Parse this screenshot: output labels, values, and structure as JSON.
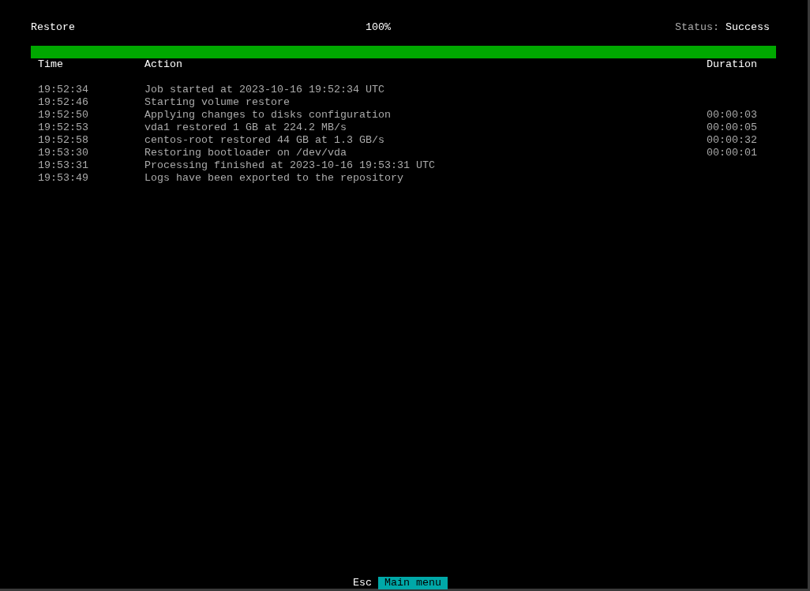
{
  "header": {
    "title": "Restore",
    "percent": "100%",
    "status_label": "Status:",
    "status_value": "Success"
  },
  "progress": {
    "level": 1.0
  },
  "table": {
    "columns": [
      "Time",
      "Action",
      "Duration"
    ],
    "rows": [
      {
        "time": "19:52:34",
        "action": "Job started at 2023-10-16 19:52:34 UTC"
      },
      {
        "time": "19:52:46",
        "action": "Starting volume restore"
      },
      {
        "time": "19:52:50",
        "action": "Applying changes to disks configuration",
        "duration": "00:00:03"
      },
      {
        "time": "19:52:53",
        "action": "vda1 restored 1 GB at 224.2 MB/s",
        "duration": "00:00:05"
      },
      {
        "time": "19:52:58",
        "action": "centos-root restored 44 GB at 1.3 GB/s",
        "duration": "00:00:32"
      },
      {
        "time": "19:53:30",
        "action": "Restoring bootloader on /dev/vda",
        "duration": "00:00:01"
      },
      {
        "time": "19:53:31",
        "action": "Processing finished at 2023-10-16 19:53:31 UTC"
      },
      {
        "time": "19:53:49",
        "action": "Logs have been exported to the repository"
      }
    ]
  },
  "footer": [
    {
      "key": "Esc",
      "label": "Main menu"
    }
  ]
}
